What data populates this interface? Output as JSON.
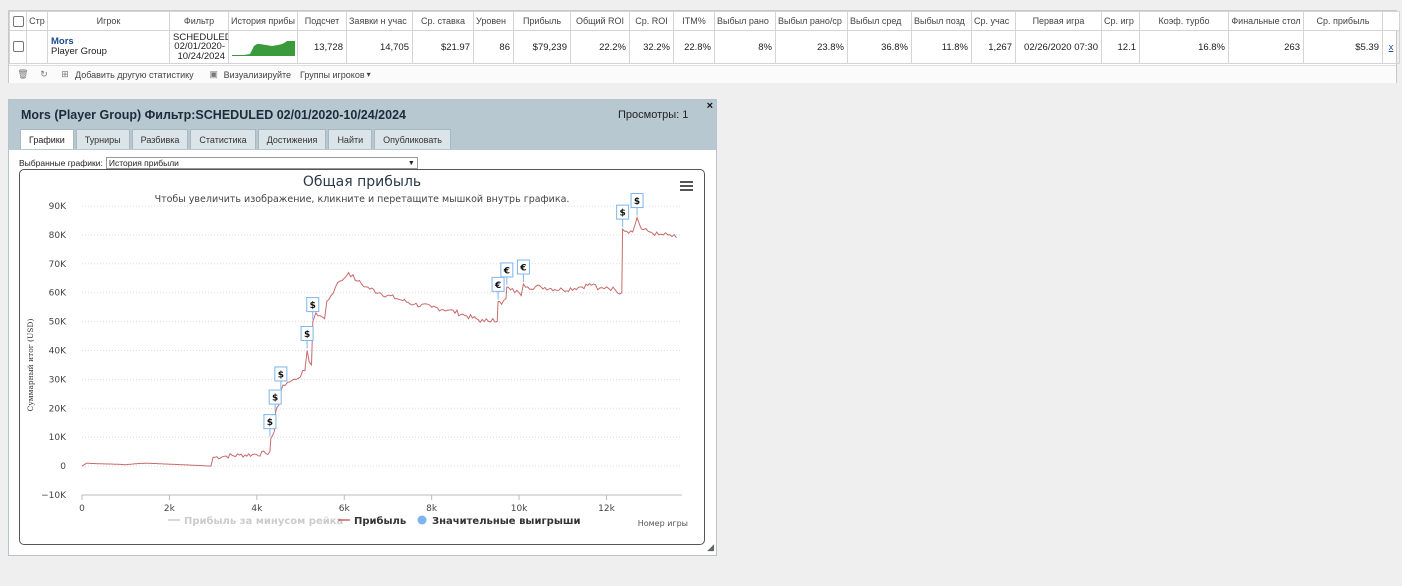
{
  "table": {
    "headers": [
      "",
      "Стр",
      "Игрок",
      "Фильтр",
      "История прибы",
      "Подсчет",
      "Заявки н учас",
      "Ср. ставка",
      "Уровен",
      "Прибыль",
      "Общий ROI",
      "Ср. ROI",
      "ITM%",
      "Выбыл рано",
      "Выбыл рано/ср",
      "Выбыл сред",
      "Выбыл позд",
      "Ср. учас",
      "Первая игра",
      "Ср. игр",
      "Коэф. турбо",
      "Финальные стол",
      "Ср. прибыль",
      ""
    ],
    "row": {
      "player_name": "Mors",
      "player_group": "Player Group",
      "filter_line1": "SCHEDULED",
      "filter_line2": "02/01/2020-",
      "filter_line3": "10/24/2024",
      "count": "13,728",
      "entries": "14,705",
      "avg_stake": "$21.97",
      "level": "86",
      "profit": "$79,239",
      "total_roi": "22.2%",
      "avg_roi": "32.2%",
      "itm": "22.8%",
      "early_out": "8%",
      "early_out_avg": "23.8%",
      "mid_out": "36.8%",
      "late_out": "11.8%",
      "avg_entrants": "1,267",
      "first_game": "02/26/2020 07:30",
      "avg_games": "12.1",
      "turbo_ratio": "16.8%",
      "final_tables": "263",
      "avg_profit": "$5.39",
      "remove": "x"
    }
  },
  "toolbar": {
    "add_stats": "Добавить другую статистику",
    "visualize": "Визуализируйте",
    "player_groups": "Группы игроков",
    "dropdown_caret": "▾"
  },
  "panel": {
    "title": "Mors (Player Group) Фильтр:SCHEDULED 02/01/2020-10/24/2024",
    "views": "Просмотры: 1",
    "close": "×",
    "tabs": [
      "Графики",
      "Турниры",
      "Разбивка",
      "Статистика",
      "Достижения",
      "Найти",
      "Опубликовать"
    ],
    "selected_label": "Выбранные графики:",
    "selected_value": "История прибыли"
  },
  "chart_data": {
    "type": "line",
    "title": "Общая прибыль",
    "subtitle": "Чтобы увеличить изображение, кликните и перетащите мышкой внутрь графика.",
    "xlabel": "Номер игры",
    "ylabel": "Суммарный итог (USD)",
    "xlim": [
      0,
      13728
    ],
    "ylim": [
      -10000,
      90000
    ],
    "yticks": [
      -10000,
      0,
      10000,
      20000,
      30000,
      40000,
      50000,
      60000,
      70000,
      80000,
      90000
    ],
    "ytick_labels": [
      "−10K",
      "0",
      "10K",
      "20K",
      "30K",
      "40K",
      "50K",
      "60K",
      "70K",
      "80K",
      "90K"
    ],
    "xticks": [
      0,
      2000,
      4000,
      6000,
      8000,
      10000,
      12000
    ],
    "xtick_labels": [
      "0",
      "2k",
      "4k",
      "6k",
      "8k",
      "10k",
      "12k"
    ],
    "grid": "horizontal dotted",
    "legend": "bottom-center",
    "series": [
      {
        "name": "Прибыль за минусом рейка",
        "color": "#cccccc",
        "hidden": true,
        "points": []
      },
      {
        "name": "Прибыль",
        "color": "#c96a6a",
        "points": [
          [
            0,
            0
          ],
          [
            100,
            1000
          ],
          [
            400,
            800
          ],
          [
            700,
            700
          ],
          [
            1000,
            500
          ],
          [
            1300,
            900
          ],
          [
            1500,
            1000
          ],
          [
            1800,
            800
          ],
          [
            2100,
            600
          ],
          [
            2400,
            400
          ],
          [
            2700,
            200
          ],
          [
            2950,
            0
          ],
          [
            3000,
            3000
          ],
          [
            3300,
            3500
          ],
          [
            3600,
            3800
          ],
          [
            3900,
            4000
          ],
          [
            4200,
            4400
          ],
          [
            4300,
            5000
          ],
          [
            4320,
            9500
          ],
          [
            4400,
            12000
          ],
          [
            4420,
            18000
          ],
          [
            4500,
            21000
          ],
          [
            4550,
            26000
          ],
          [
            4600,
            28000
          ],
          [
            4700,
            29000
          ],
          [
            4900,
            30000
          ],
          [
            5100,
            33000
          ],
          [
            5150,
            40000
          ],
          [
            5200,
            36000
          ],
          [
            5250,
            35000
          ],
          [
            5280,
            50000
          ],
          [
            5350,
            53000
          ],
          [
            5450,
            52000
          ],
          [
            5550,
            51000
          ],
          [
            5600,
            57000
          ],
          [
            5700,
            59000
          ],
          [
            5800,
            62000
          ],
          [
            5900,
            64000
          ],
          [
            6000,
            65000
          ],
          [
            6100,
            67000
          ],
          [
            6300,
            64000
          ],
          [
            6500,
            62000
          ],
          [
            6800,
            60000
          ],
          [
            7200,
            58000
          ],
          [
            7600,
            56000
          ],
          [
            8000,
            55000
          ],
          [
            8400,
            54000
          ],
          [
            8800,
            52000
          ],
          [
            9200,
            50000
          ],
          [
            9400,
            51000
          ],
          [
            9500,
            50000
          ],
          [
            9520,
            57000
          ],
          [
            9600,
            56000
          ],
          [
            9700,
            58000
          ],
          [
            9720,
            62000
          ],
          [
            9800,
            61000
          ],
          [
            10000,
            60000
          ],
          [
            10050,
            59000
          ],
          [
            10100,
            63000
          ],
          [
            10200,
            62000
          ],
          [
            10500,
            62000
          ],
          [
            11000,
            61000
          ],
          [
            11400,
            62000
          ],
          [
            11700,
            63000
          ],
          [
            11800,
            61000
          ],
          [
            12000,
            62000
          ],
          [
            12200,
            61000
          ],
          [
            12350,
            60000
          ],
          [
            12370,
            82000
          ],
          [
            12600,
            81000
          ],
          [
            12700,
            86000
          ],
          [
            12800,
            82000
          ],
          [
            13000,
            81000
          ],
          [
            13200,
            80000
          ],
          [
            13400,
            80000
          ],
          [
            13600,
            79000
          ]
        ]
      },
      {
        "name": "Значительные выигрыши",
        "color": "#7cb5ec",
        "marker": "circle",
        "flags": [
          {
            "x": 4300,
            "y": 9500,
            "label": "$"
          },
          {
            "x": 4420,
            "y": 18000,
            "label": "$"
          },
          {
            "x": 4550,
            "y": 26000,
            "label": "$"
          },
          {
            "x": 5150,
            "y": 40000,
            "label": "$"
          },
          {
            "x": 5280,
            "y": 50000,
            "label": "$"
          },
          {
            "x": 9520,
            "y": 57000,
            "label": "€"
          },
          {
            "x": 9720,
            "y": 62000,
            "label": "€"
          },
          {
            "x": 10100,
            "y": 63000,
            "label": "€"
          },
          {
            "x": 12370,
            "y": 82000,
            "label": "$"
          },
          {
            "x": 12700,
            "y": 86000,
            "label": "$"
          }
        ]
      }
    ]
  }
}
